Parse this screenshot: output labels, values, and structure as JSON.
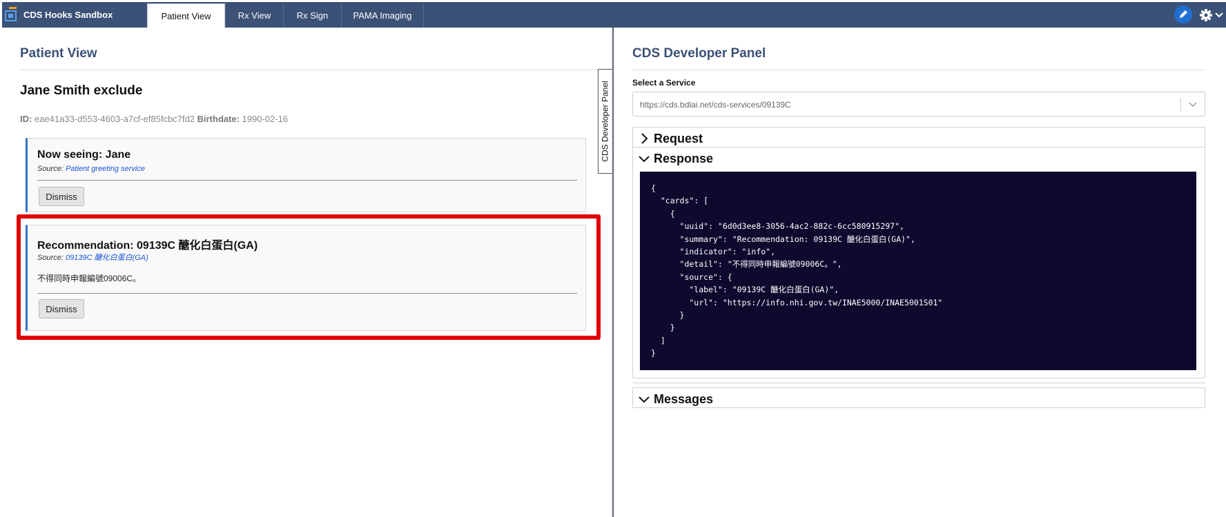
{
  "app": {
    "brand": "CDS Hooks Sandbox",
    "tabs": [
      {
        "label": "Patient View",
        "active": true
      },
      {
        "label": "Rx View",
        "active": false
      },
      {
        "label": "Rx Sign",
        "active": false
      },
      {
        "label": "PAMA Imaging",
        "active": false
      }
    ],
    "icons": [
      "pencil-icon",
      "gear-icon",
      "chevron-down-icon"
    ],
    "colors": {
      "nav": "#3b5176",
      "accent": "#1f6fd0",
      "highlight": "#e10000",
      "code_bg": "#0d0a2e"
    }
  },
  "left": {
    "title": "Patient View",
    "patient": {
      "name": "Jane Smith exclude",
      "id_label": "ID:",
      "id": "eae41a33-d553-4603-a7cf-ef85fcbc7fd2",
      "birthdate_label": "Birthdate:",
      "birthdate": "1990-02-16"
    },
    "side_tab": "CDS Developer Panel",
    "cards": [
      {
        "title": "Now seeing: Jane",
        "source_label": "Source:",
        "source": "Patient greeting service",
        "dismiss": "Dismiss"
      },
      {
        "title": "Recommendation: 09139C 醣化白蛋白(GA)",
        "source_label": "Source:",
        "source": "09139C 醣化白蛋白(GA)",
        "detail": "不得同時申報編號09006C。",
        "dismiss": "Dismiss"
      }
    ]
  },
  "right": {
    "title": "CDS Developer Panel",
    "service_label": "Select a Service",
    "service_value": "https://cds.bdlai.net/cds-services/09139C",
    "request_label": "Request",
    "response_label": "Response",
    "messages_label": "Messages",
    "response_json": "{\n  \"cards\": [\n    {\n      \"uuid\": \"6d0d3ee8-3056-4ac2-882c-6cc580915297\",\n      \"summary\": \"Recommendation: 09139C 醣化白蛋白(GA)\",\n      \"indicator\": \"info\",\n      \"detail\": \"不得同時申報編號09006C。\",\n      \"source\": {\n        \"label\": \"09139C 醣化白蛋白(GA)\",\n        \"url\": \"https://info.nhi.gov.tw/INAE5000/INAE5001S01\"\n      }\n    }\n  ]\n}"
  }
}
